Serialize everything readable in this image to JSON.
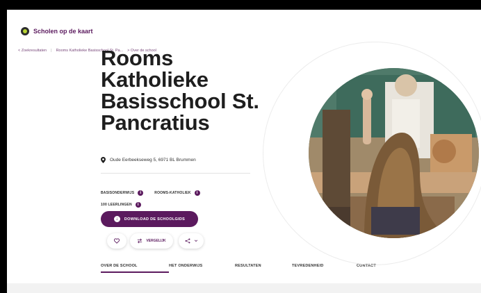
{
  "site": {
    "name": "Scholen op de kaart"
  },
  "breadcrumb": [
    "< Zoekresultaten",
    "Rooms Katholieke Basisschool St. Pa...",
    "> Over de school"
  ],
  "school": {
    "title": "Rooms Katholieke Basisschool St. Pancratius",
    "address": "Oude Eerbeekseweg 5, 6971 BL Brummen",
    "tags": [
      "BASISONDERWIJS",
      "ROOMS-KATHOLIEK"
    ],
    "students": "100 LEERLINGEN"
  },
  "actions": {
    "download": "DOWNLOAD DE SCHOOLGIDS",
    "compare": "VERGELIJK"
  },
  "tabs": [
    "OVER DE SCHOOL",
    "HET ONDERWIJS",
    "RESULTATEN",
    "TEVREDENHEID",
    "CONTACT"
  ],
  "colors": {
    "brand": "#5b1a5e",
    "logo_accent": "#b7d433"
  },
  "icons": [
    "logo-icon",
    "pin-icon",
    "info-icon",
    "download-icon",
    "heart-icon",
    "compare-icon",
    "share-icon",
    "chevron-down-icon"
  ]
}
